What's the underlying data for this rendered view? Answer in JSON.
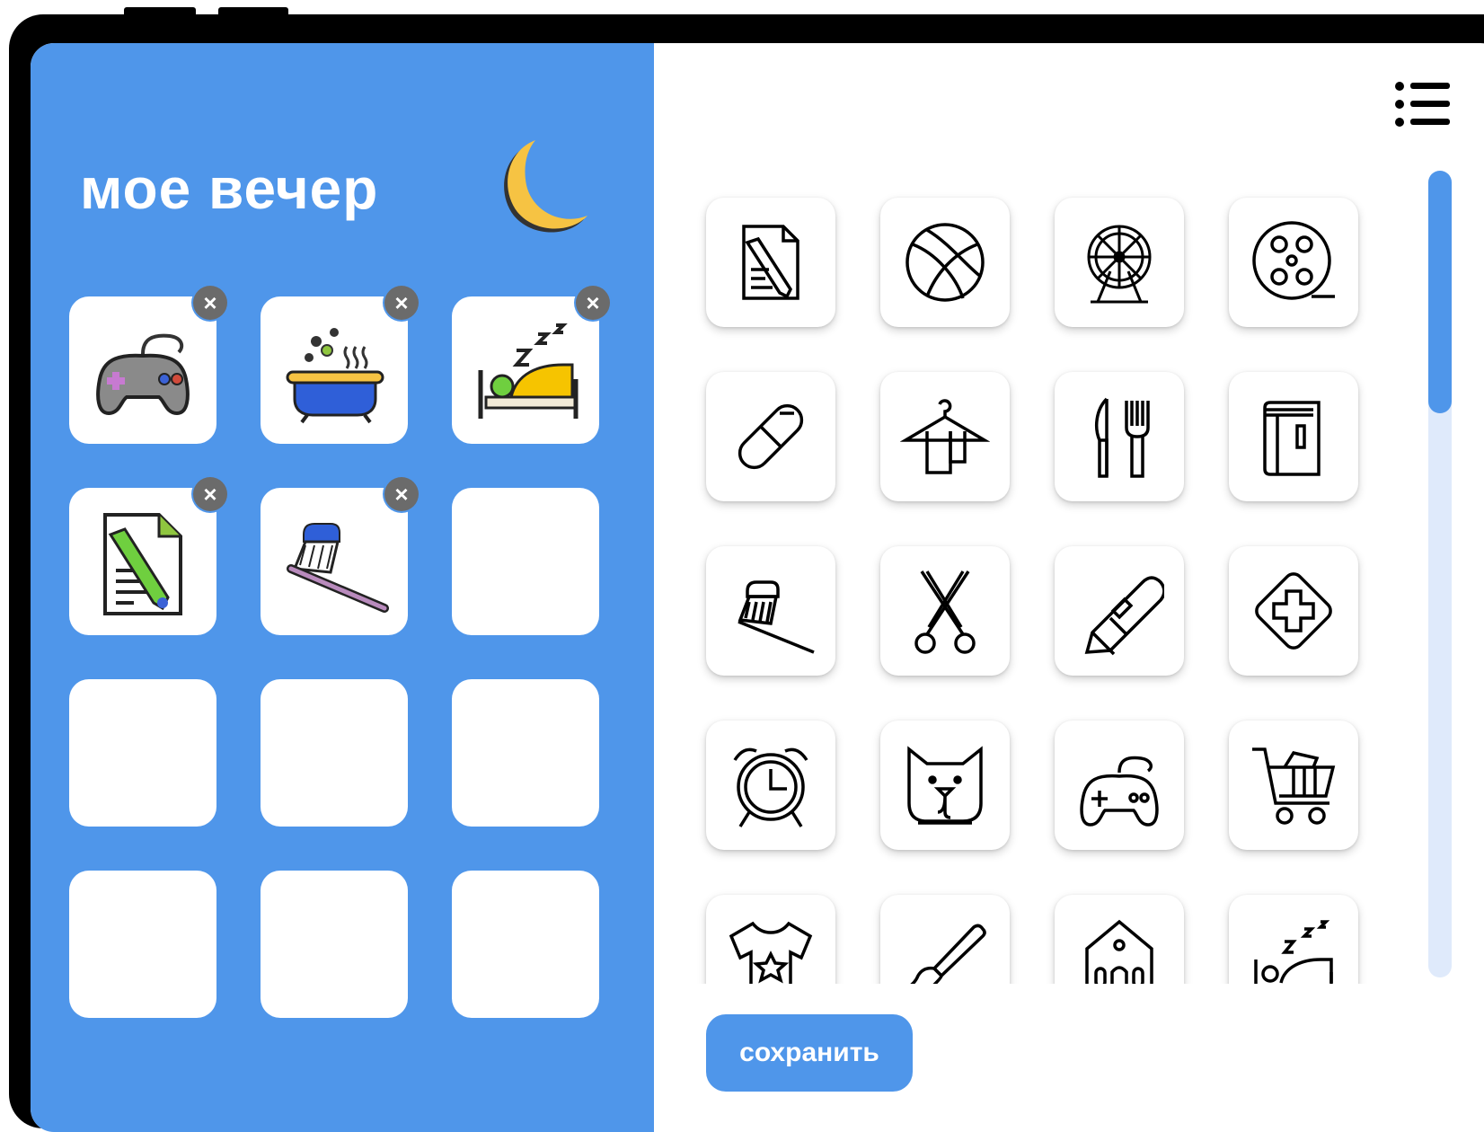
{
  "routine": {
    "title": "мое вечер",
    "icon": "moon-icon",
    "slots": [
      {
        "icon": "gamepad-color-icon",
        "removable": true
      },
      {
        "icon": "bath-color-icon",
        "removable": true
      },
      {
        "icon": "sleep-bed-color-icon",
        "removable": true
      },
      {
        "icon": "homework-color-icon",
        "removable": true
      },
      {
        "icon": "toothbrush-color-icon",
        "removable": true
      },
      {
        "icon": "",
        "removable": false
      },
      {
        "icon": "",
        "removable": false
      },
      {
        "icon": "",
        "removable": false
      },
      {
        "icon": "",
        "removable": false
      },
      {
        "icon": "",
        "removable": false
      },
      {
        "icon": "",
        "removable": false
      },
      {
        "icon": "",
        "removable": false
      }
    ],
    "remove_symbol": "×"
  },
  "library": {
    "icons": [
      "homework-icon",
      "basketball-icon",
      "ferris-wheel-icon",
      "film-reel-icon",
      "pill-icon",
      "towel-hanger-icon",
      "knife-fork-icon",
      "book-icon",
      "toothbrush-icon",
      "scissors-icon",
      "utility-knife-icon",
      "first-aid-icon",
      "alarm-clock-icon",
      "dog-face-icon",
      "gamepad-icon",
      "shopping-cart-icon",
      "tshirt-icon",
      "paintbrush-icon",
      "school-building-icon",
      "sleep-bed-icon"
    ],
    "scroll_position": 0.0
  },
  "menu_icon": "menu-list-icon",
  "save_button": {
    "label": "сохранить"
  },
  "colors": {
    "accent": "#4f96ea",
    "track": "#dfeafb",
    "moon": "#f6c343",
    "badge": "#6b6b6b"
  }
}
